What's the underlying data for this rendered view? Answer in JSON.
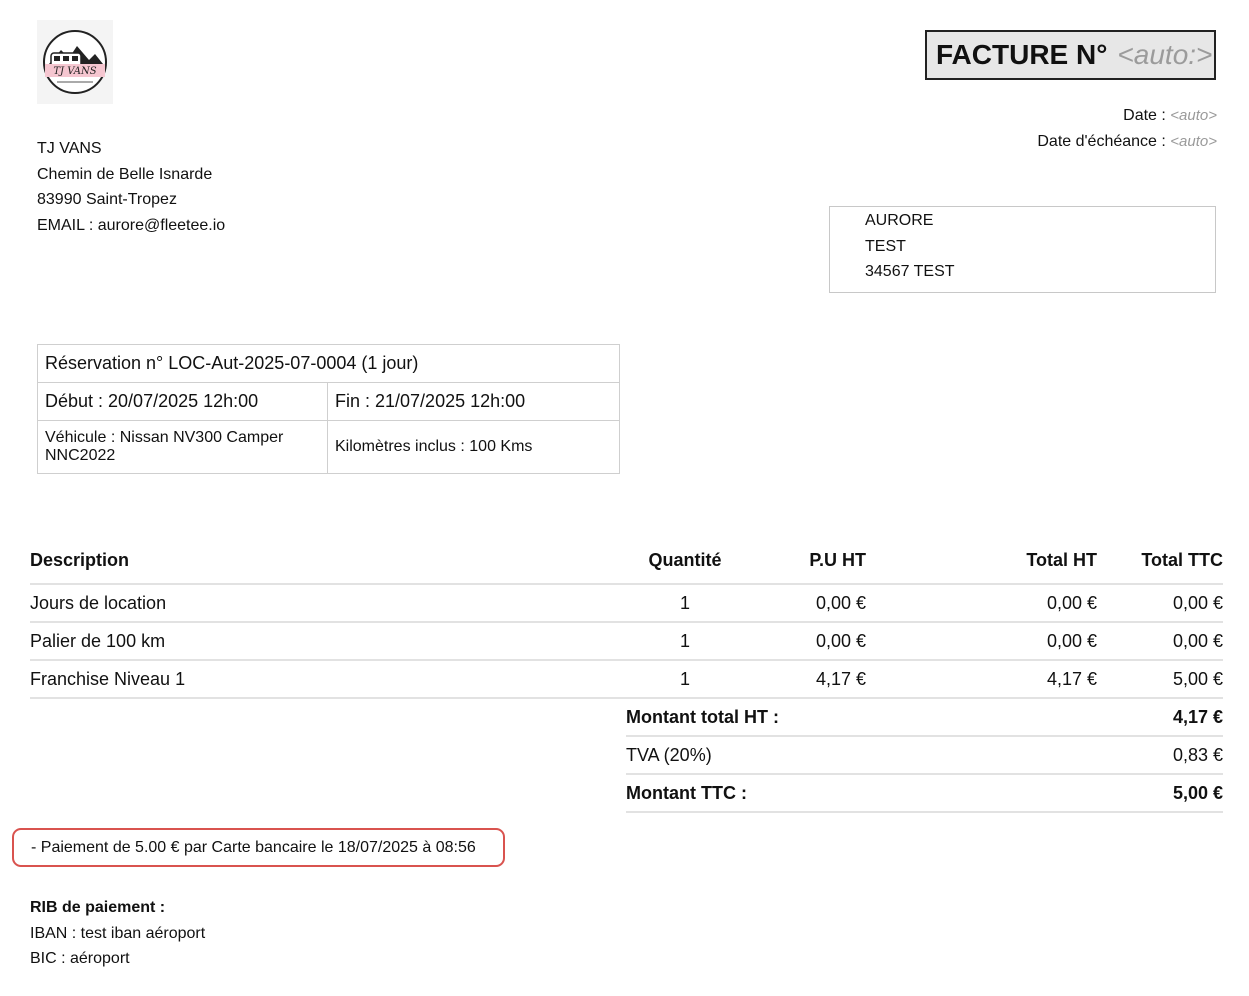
{
  "company": {
    "logo_icon": "tj-vans-logo",
    "logo_text": "TJ VANS",
    "name": "TJ VANS",
    "street": "Chemin de Belle Isnarde",
    "city": "83990 Saint-Tropez",
    "email": "EMAIL : aurore@fleetee.io"
  },
  "invoice": {
    "title": "FACTURE N°",
    "number": "<auto:>",
    "date_label": "Date : ",
    "date_value": "<auto>",
    "due_label": "Date d'échéance : ",
    "due_value": "<auto>"
  },
  "client": {
    "name": "AURORE",
    "address": "TEST",
    "city": "34567 TEST"
  },
  "reservation": {
    "title": "Réservation n° LOC-Aut-2025-07-0004 (1 jour)",
    "start": "Début : 20/07/2025 12h:00",
    "end": "Fin : 21/07/2025 12h:00",
    "vehicle": "Véhicule : Nissan NV300 Camper NNC2022",
    "km": "Kilomètres inclus : 100 Kms"
  },
  "lines": {
    "headers": {
      "description": "Description",
      "quantity": "Quantité",
      "unit_price": "P.U HT",
      "total_ht": "Total HT",
      "total_ttc": "Total TTC"
    },
    "rows": [
      {
        "description": "Jours de location",
        "quantity": "1",
        "unit_price": "0,00 €",
        "total_ht": "0,00 €",
        "total_ttc": "0,00 €"
      },
      {
        "description": "Palier de 100 km",
        "quantity": "1",
        "unit_price": "0,00 €",
        "total_ht": "0,00 €",
        "total_ttc": "0,00 €"
      },
      {
        "description": "Franchise Niveau 1",
        "quantity": "1",
        "unit_price": "4,17 €",
        "total_ht": "4,17 €",
        "total_ttc": "5,00 €"
      }
    ]
  },
  "totals": {
    "ht_label": "Montant total HT :",
    "ht_value": "4,17 €",
    "tva_label": "TVA (20%)",
    "tva_value": "0,83 €",
    "ttc_label": "Montant TTC :",
    "ttc_value": "5,00 €"
  },
  "payment": {
    "text": "- Paiement de 5.00 € par Carte bancaire le 18/07/2025 à 08:56",
    "highlight_color": "#d9534f"
  },
  "rib": {
    "title": "RIB de paiement :",
    "iban": "IBAN : test iban aéroport",
    "bic": "BIC : aéroport"
  }
}
